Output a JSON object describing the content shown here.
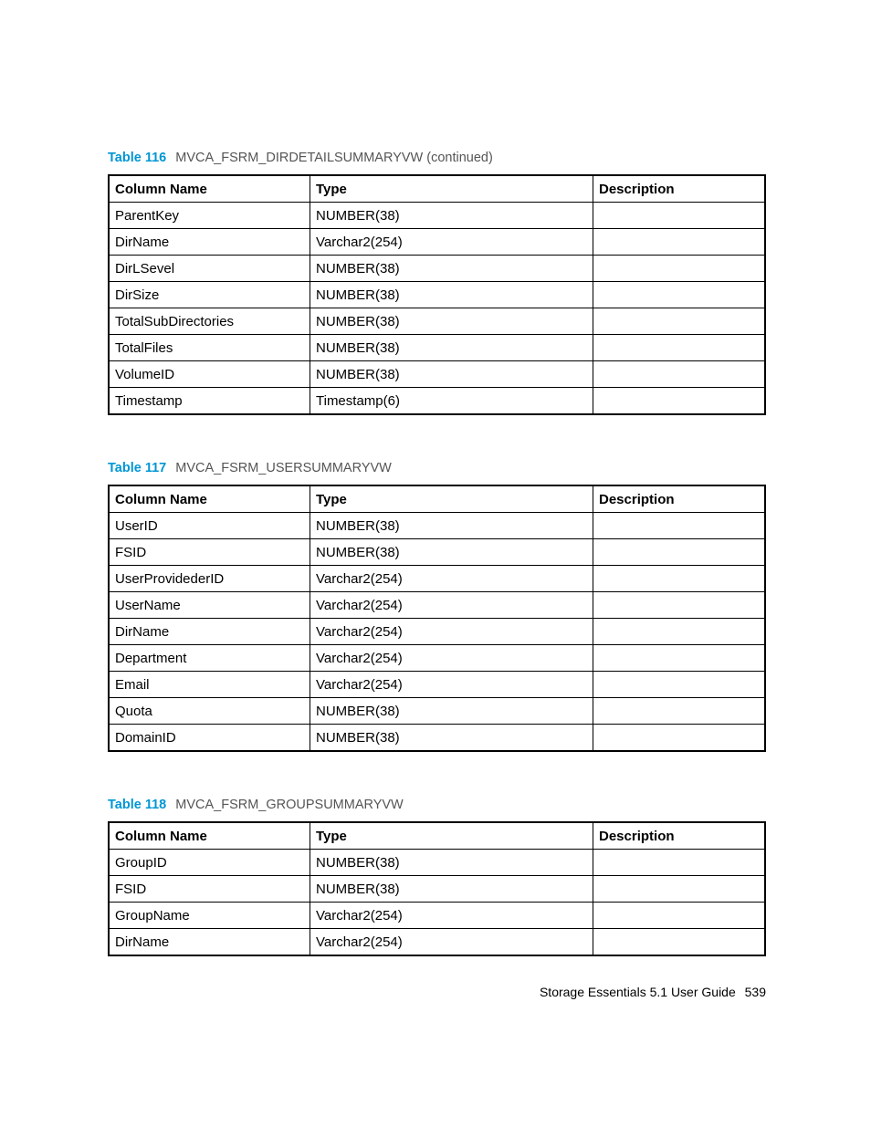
{
  "tables": [
    {
      "caption_num": "Table 116",
      "caption_title": "MVCA_FSRM_DIRDETAILSUMMARYVW (continued)",
      "headers": {
        "c1": "Column Name",
        "c2": "Type",
        "c3": "Description"
      },
      "rows": [
        {
          "c1": "ParentKey",
          "c2": "NUMBER(38)",
          "c3": ""
        },
        {
          "c1": "DirName",
          "c2": "Varchar2(254)",
          "c3": ""
        },
        {
          "c1": "DirLSevel",
          "c2": "NUMBER(38)",
          "c3": ""
        },
        {
          "c1": "DirSize",
          "c2": "NUMBER(38)",
          "c3": ""
        },
        {
          "c1": "TotalSubDirectories",
          "c2": "NUMBER(38)",
          "c3": ""
        },
        {
          "c1": "TotalFiles",
          "c2": "NUMBER(38)",
          "c3": ""
        },
        {
          "c1": "VolumeID",
          "c2": "NUMBER(38)",
          "c3": ""
        },
        {
          "c1": "Timestamp",
          "c2": "Timestamp(6)",
          "c3": ""
        }
      ]
    },
    {
      "caption_num": "Table 117",
      "caption_title": "MVCA_FSRM_USERSUMMARYVW",
      "headers": {
        "c1": "Column Name",
        "c2": "Type",
        "c3": "Description"
      },
      "rows": [
        {
          "c1": "UserID",
          "c2": "NUMBER(38)",
          "c3": ""
        },
        {
          "c1": "FSID",
          "c2": "NUMBER(38)",
          "c3": ""
        },
        {
          "c1": "UserProvidederID",
          "c2": "Varchar2(254)",
          "c3": ""
        },
        {
          "c1": "UserName",
          "c2": "Varchar2(254)",
          "c3": ""
        },
        {
          "c1": "DirName",
          "c2": "Varchar2(254)",
          "c3": ""
        },
        {
          "c1": "Department",
          "c2": "Varchar2(254)",
          "c3": ""
        },
        {
          "c1": "Email",
          "c2": "Varchar2(254)",
          "c3": ""
        },
        {
          "c1": "Quota",
          "c2": "NUMBER(38)",
          "c3": ""
        },
        {
          "c1": "DomainID",
          "c2": "NUMBER(38)",
          "c3": ""
        }
      ]
    },
    {
      "caption_num": "Table 118",
      "caption_title": "MVCA_FSRM_GROUPSUMMARYVW",
      "headers": {
        "c1": "Column Name",
        "c2": "Type",
        "c3": "Description"
      },
      "rows": [
        {
          "c1": "GroupID",
          "c2": "NUMBER(38)",
          "c3": ""
        },
        {
          "c1": "FSID",
          "c2": "NUMBER(38)",
          "c3": ""
        },
        {
          "c1": "GroupName",
          "c2": "Varchar2(254)",
          "c3": ""
        },
        {
          "c1": "DirName",
          "c2": "Varchar2(254)",
          "c3": ""
        }
      ]
    }
  ],
  "footer": {
    "doc": "Storage Essentials 5.1 User Guide",
    "page": "539"
  }
}
